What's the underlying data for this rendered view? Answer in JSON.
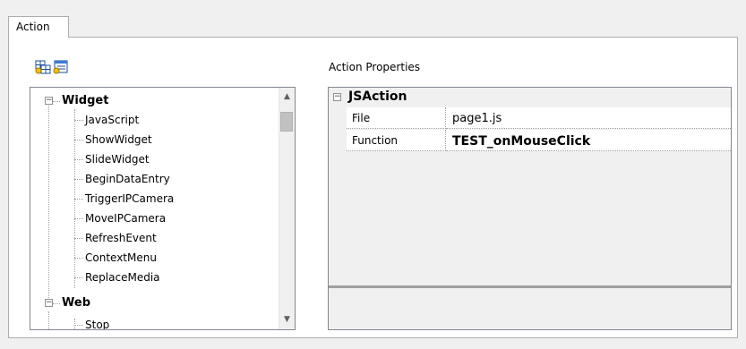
{
  "tab": {
    "label": "Action"
  },
  "toolbar": {
    "add_icon": "add-node-icon",
    "edit_icon": "edit-node-icon"
  },
  "properties": {
    "label": "Action Properties"
  },
  "tree": {
    "groups": [
      {
        "label": "Widget",
        "items": [
          "JavaScript",
          "ShowWidget",
          "SlideWidget",
          "BeginDataEntry",
          "TriggerIPCamera",
          "MoveIPCamera",
          "RefreshEvent",
          "ContextMenu",
          "ReplaceMedia"
        ]
      },
      {
        "label": "Web",
        "items": [
          "Stop"
        ]
      }
    ]
  },
  "grid": {
    "category": "JSAction",
    "rows": [
      {
        "name": "File",
        "value": "page1.js"
      },
      {
        "name": "Function",
        "value": "TEST_onMouseClick"
      }
    ]
  },
  "colors": {
    "panel_bg": "#ffffff",
    "window_bg": "#f0f0f0",
    "border": "#adadad"
  }
}
